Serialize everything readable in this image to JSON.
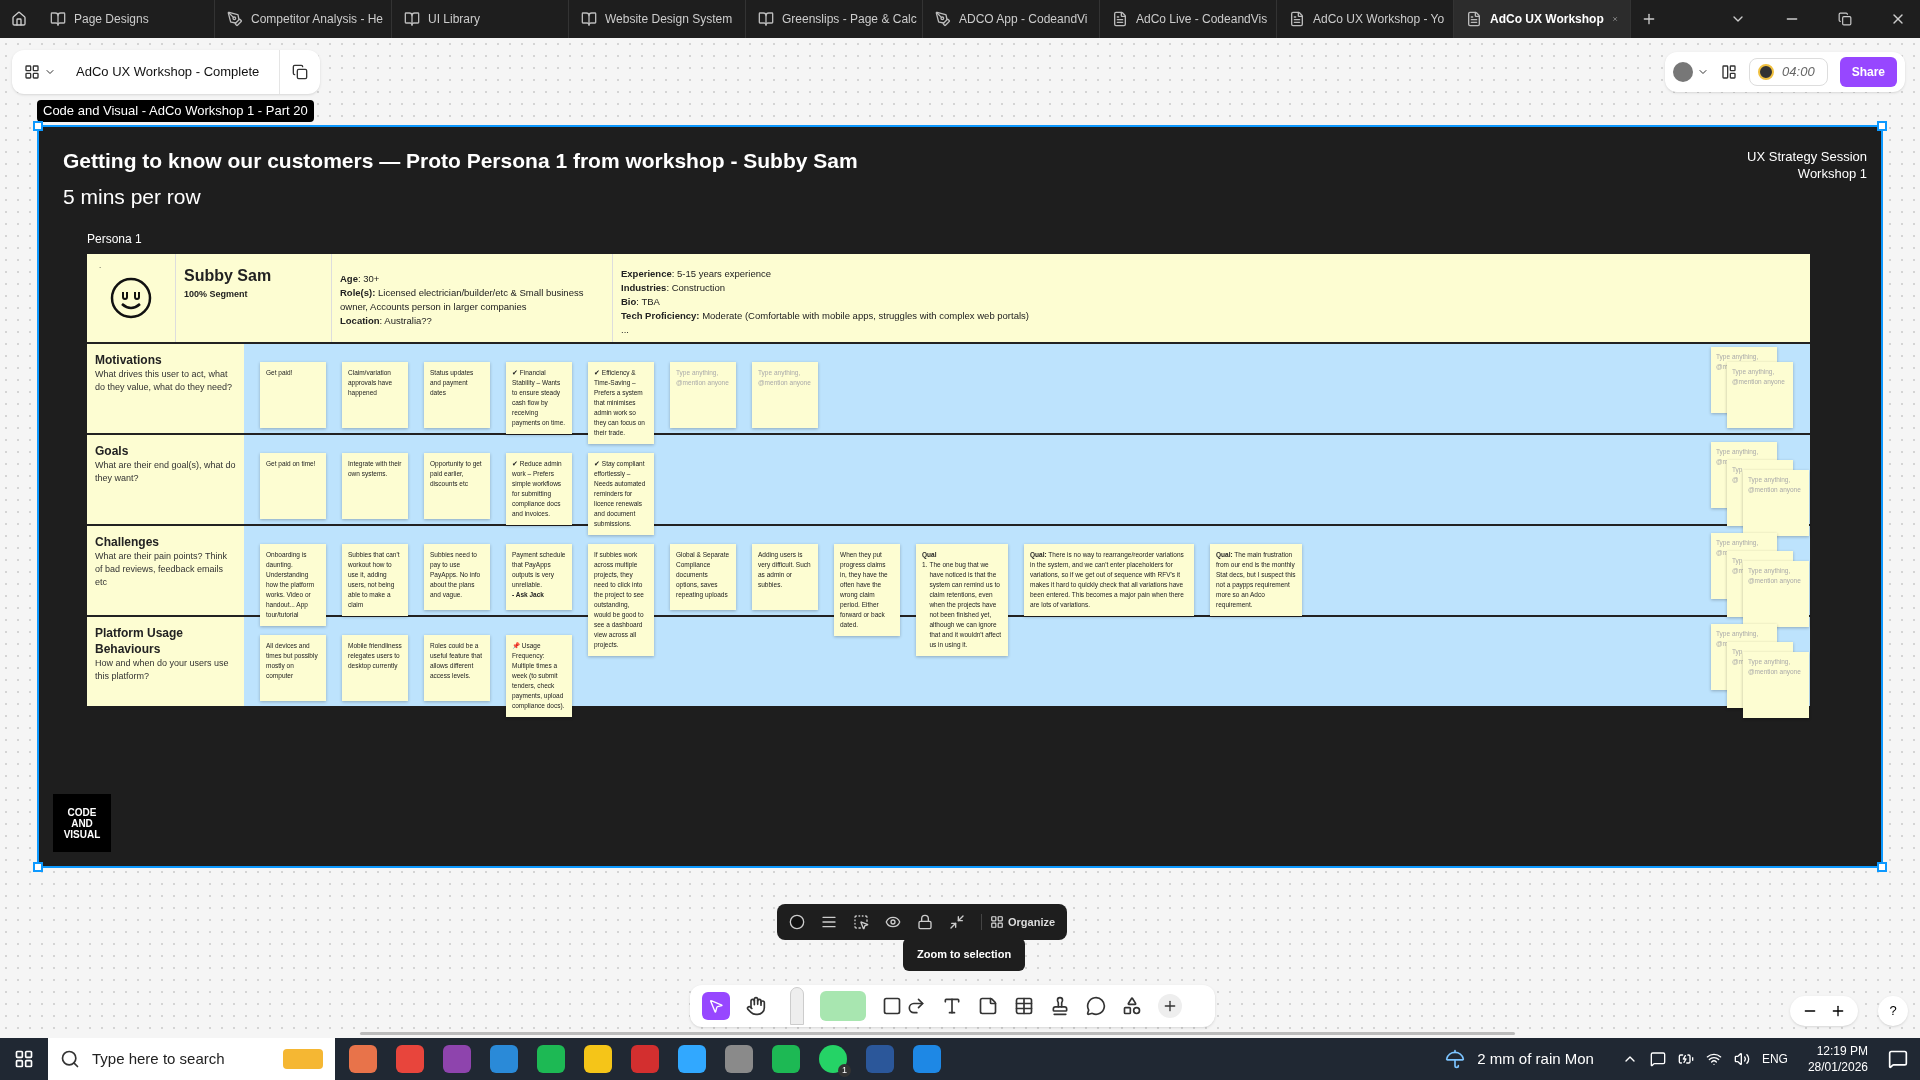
{
  "tabs": [
    {
      "label": "Page Designs",
      "kind": "book",
      "selected": false
    },
    {
      "label": "Competitor Analysis - He",
      "kind": "pen",
      "selected": false
    },
    {
      "label": "UI Library",
      "kind": "book",
      "selected": false
    },
    {
      "label": "Website Design System",
      "kind": "book",
      "selected": false
    },
    {
      "label": "Greenslips - Page & Calc",
      "kind": "book",
      "selected": false
    },
    {
      "label": "ADCO App - CodeandVi",
      "kind": "pen",
      "selected": false
    },
    {
      "label": "AdCo Live - CodeandVis",
      "kind": "board",
      "selected": false
    },
    {
      "label": "AdCo UX Workshop - Yo",
      "kind": "board",
      "selected": false
    },
    {
      "label": "AdCo UX Workshop",
      "kind": "board",
      "selected": true
    }
  ],
  "file": {
    "name": "AdCo UX Workshop - Complete"
  },
  "top_right": {
    "timer": "04:00",
    "share": "Share"
  },
  "frame": {
    "label": "Code and Visual - AdCo Workshop 1 - Part 20",
    "title": "Getting to know our customers — Proto Persona 1 from workshop - Subby Sam",
    "subtitle": "5 mins per row",
    "session": [
      "UX Strategy Session",
      "Workshop 1"
    ],
    "section": "Persona 1",
    "persona": {
      "mark": ".",
      "name": "Subby Sam",
      "segment": "100% Segment",
      "facts_left": [
        "**Age**:  30+",
        "**Role(s):** Licensed electrician/builder/etc & Small business owner, Accounts person in larger companies",
        "**Location**:  Australia??"
      ],
      "facts_right": [
        "**Experience**: 5-15 years experience",
        "**Industries**: Construction",
        "**Bio**: TBA",
        "**Tech Proficiency:** Moderate (Comfortable with mobile apps, struggles with complex web portals)",
        "..."
      ]
    },
    "rows": [
      {
        "title": "Motivations",
        "question": "What drives this user to act, what do they value, what do they need?",
        "notes": [
          {
            "kind": "note",
            "text": "Get paid!"
          },
          {
            "kind": "note",
            "text": "Claim/variation approvals have happened"
          },
          {
            "kind": "note",
            "text": "Status updates and payment dates"
          },
          {
            "kind": "note",
            "text": "✔ Financial Stability – Wants to ensure steady cash flow by receiving payments on time."
          },
          {
            "kind": "note",
            "text": "✔ Efficiency & Time-Saving – Prefers a system that minimises admin work so they can focus on their trade."
          },
          {
            "kind": "placeholder",
            "text": "Type anything, @mention anyone"
          },
          {
            "kind": "placeholder",
            "text": "Type anything, @mention anyone"
          }
        ],
        "stack": [
          "Type anything,\n@m",
          "Type anything,\n@mention anyone"
        ]
      },
      {
        "title": "Goals",
        "question": "What are their end goal(s), what do they want?",
        "notes": [
          {
            "kind": "note",
            "text": "Get paid on time!"
          },
          {
            "kind": "note",
            "text": "Integrate with their own systems."
          },
          {
            "kind": "note",
            "text": "Opportunity to get paid earlier, discounts etc"
          },
          {
            "kind": "note",
            "text": "✔ Reduce admin work – Prefers simple workflows for submitting compliance docs and invoices."
          },
          {
            "kind": "note",
            "text": "✔ Stay compliant effortlessly – Needs automated reminders for licence renewals and document submissions."
          }
        ],
        "stack": [
          "Type anything,\n@m",
          "Typ\n@",
          "Type anything,\n@mention anyone"
        ]
      },
      {
        "title": "Challenges",
        "question": "What are their pain points? Think of bad reviews, feedback emails etc",
        "notes": [
          {
            "kind": "note",
            "text": "Onboarding is daunting. Understanding how the platform works. Video or handout... App tour/tutorial"
          },
          {
            "kind": "note",
            "text": "Subbies that can't workout how to use it, adding users, not being able to make a claim"
          },
          {
            "kind": "note",
            "text": "Subbies need to pay to use PayApps. No info about the plans and vague."
          },
          {
            "kind": "note",
            "text": "Payment schedule that PayApps outputs is very unreliable.\n**- Ask Jack**"
          },
          {
            "kind": "note",
            "text": "If subbies work across multiple projects, they need to click into the project to see outstanding, would be good to see a dashboard view across all projects."
          },
          {
            "kind": "note",
            "text": "Global & Separate Compliance documents options, saves repeating uploads"
          },
          {
            "kind": "note",
            "text": "Adding users is very difficult. Such as admin or subbies."
          },
          {
            "kind": "note",
            "text": "When they put progress claims in, they have the often have the wrong claim period. Either forward or back dated."
          },
          {
            "kind": "qual-list",
            "label": "Qual",
            "number": "1.",
            "text": "The one bug that we have noticed is that the system can remind us to claim retentions, even when the projects have not been finished yet, although we can ignore that and it wouldn't affect us in using it."
          },
          {
            "kind": "qual",
            "text": "**Qual:** There is no way to rearrange/reorder variations in the system, and we can't enter placeholders for variations, so if we get out of sequence with RFV's it makes it hard to quickly check that all variations have been entered.  This becomes a major pain when there are lots of variations."
          },
          {
            "kind": "qual",
            "text": "**Qual:** The main frustration from our end is the monthly Stat decs, but I suspect this not a paypps requirement more so an Adco requirement."
          }
        ],
        "stack": [
          "Type anything,\n@m",
          "Typ\n@m",
          "Type anything,\n@mention anyone"
        ]
      },
      {
        "title": "Platform Usage Behaviours",
        "question": "How and when do your users use this platform?",
        "notes": [
          {
            "kind": "note",
            "text": "All devices and times but possibly mostly on computer"
          },
          {
            "kind": "note",
            "text": "Mobile friendliness relegates users to desktop currently"
          },
          {
            "kind": "note",
            "text": "Roles could be a useful feature that allows different access levels."
          },
          {
            "kind": "note",
            "text": "📌 Usage Frequency: Multiple times a week (to submit tenders, check payments, upload compliance docs)."
          }
        ],
        "stack": [
          "Type anything,\n@m",
          "Typ\n@m",
          "Type anything,\n@mention anyone"
        ]
      }
    ],
    "logo": [
      "CODE",
      "AND",
      "VISUAL"
    ]
  },
  "help": "?",
  "toolbar": {
    "organize": "Organize",
    "tooltip": "Zoom to selection"
  },
  "taskbar": {
    "search_placeholder": "Type here to search",
    "weather": "2 mm of rain Mon",
    "language": "ENG",
    "time": "12:19 PM",
    "date": "28/01/2026",
    "whatsapp_badge": "1"
  }
}
